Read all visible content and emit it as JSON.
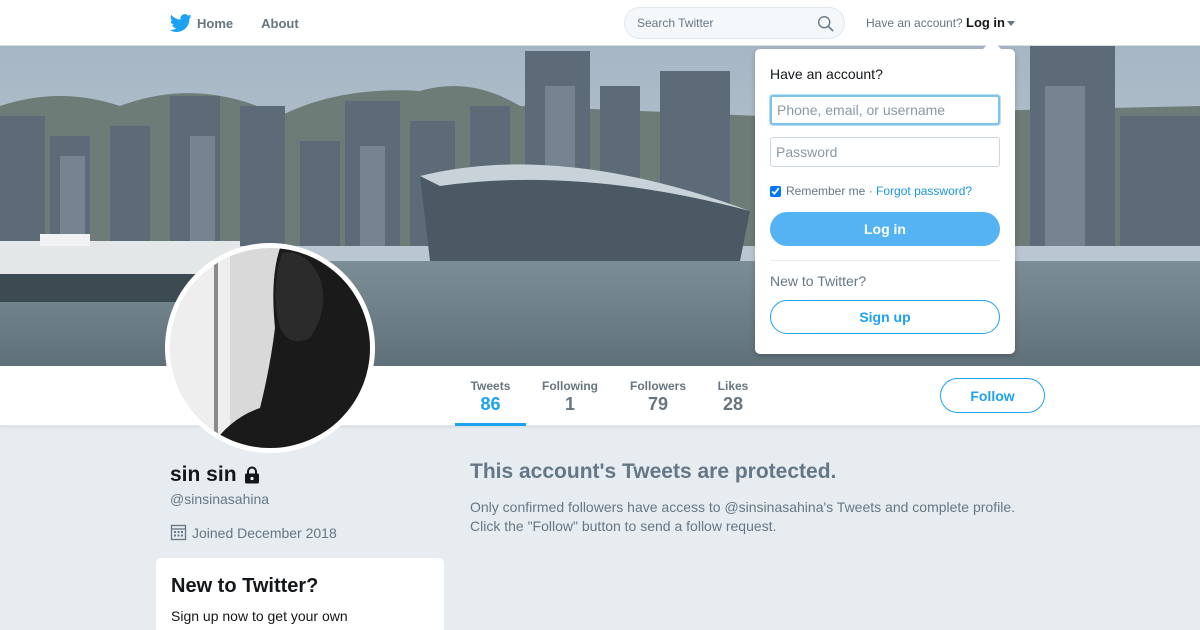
{
  "colors": {
    "accent": "#1da1f2",
    "login_button": "#55b3f3",
    "page_bg": "#e6ecf0",
    "muted": "#657786"
  },
  "topbar": {
    "home_label": "Home",
    "about_label": "About",
    "search_placeholder": "Search Twitter",
    "have_account": "Have an account?",
    "login_label": "Log in",
    "icons": {
      "logo": "twitter-bird-icon",
      "search": "search-icon"
    }
  },
  "profile": {
    "name": "sin sin",
    "handle": "@sinsinasahina",
    "joined": "Joined December 2018",
    "protected_icon": "lock-icon",
    "stats": [
      {
        "label": "Tweets",
        "value": "86",
        "active": true
      },
      {
        "label": "Following",
        "value": "1",
        "active": false
      },
      {
        "label": "Followers",
        "value": "79",
        "active": false
      },
      {
        "label": "Likes",
        "value": "28",
        "active": false
      }
    ],
    "follow_label": "Follow"
  },
  "protected": {
    "title": "This account's Tweets are protected.",
    "body_line1": "Only confirmed followers have access to @sinsinasahina's Tweets and complete profile.",
    "body_line2": "Click the \"Follow\" button to send a follow request."
  },
  "sidebar_card": {
    "title": "New to Twitter?",
    "text": "Sign up now to get your own personalized timeline!"
  },
  "login_dropdown": {
    "heading": "Have an account?",
    "username_placeholder": "Phone, email, or username",
    "password_placeholder": "Password",
    "remember_label": "Remember me",
    "separator": "·",
    "forgot_label": "Forgot password?",
    "login_button": "Log in",
    "new_heading": "New to Twitter?",
    "signup_button": "Sign up"
  }
}
